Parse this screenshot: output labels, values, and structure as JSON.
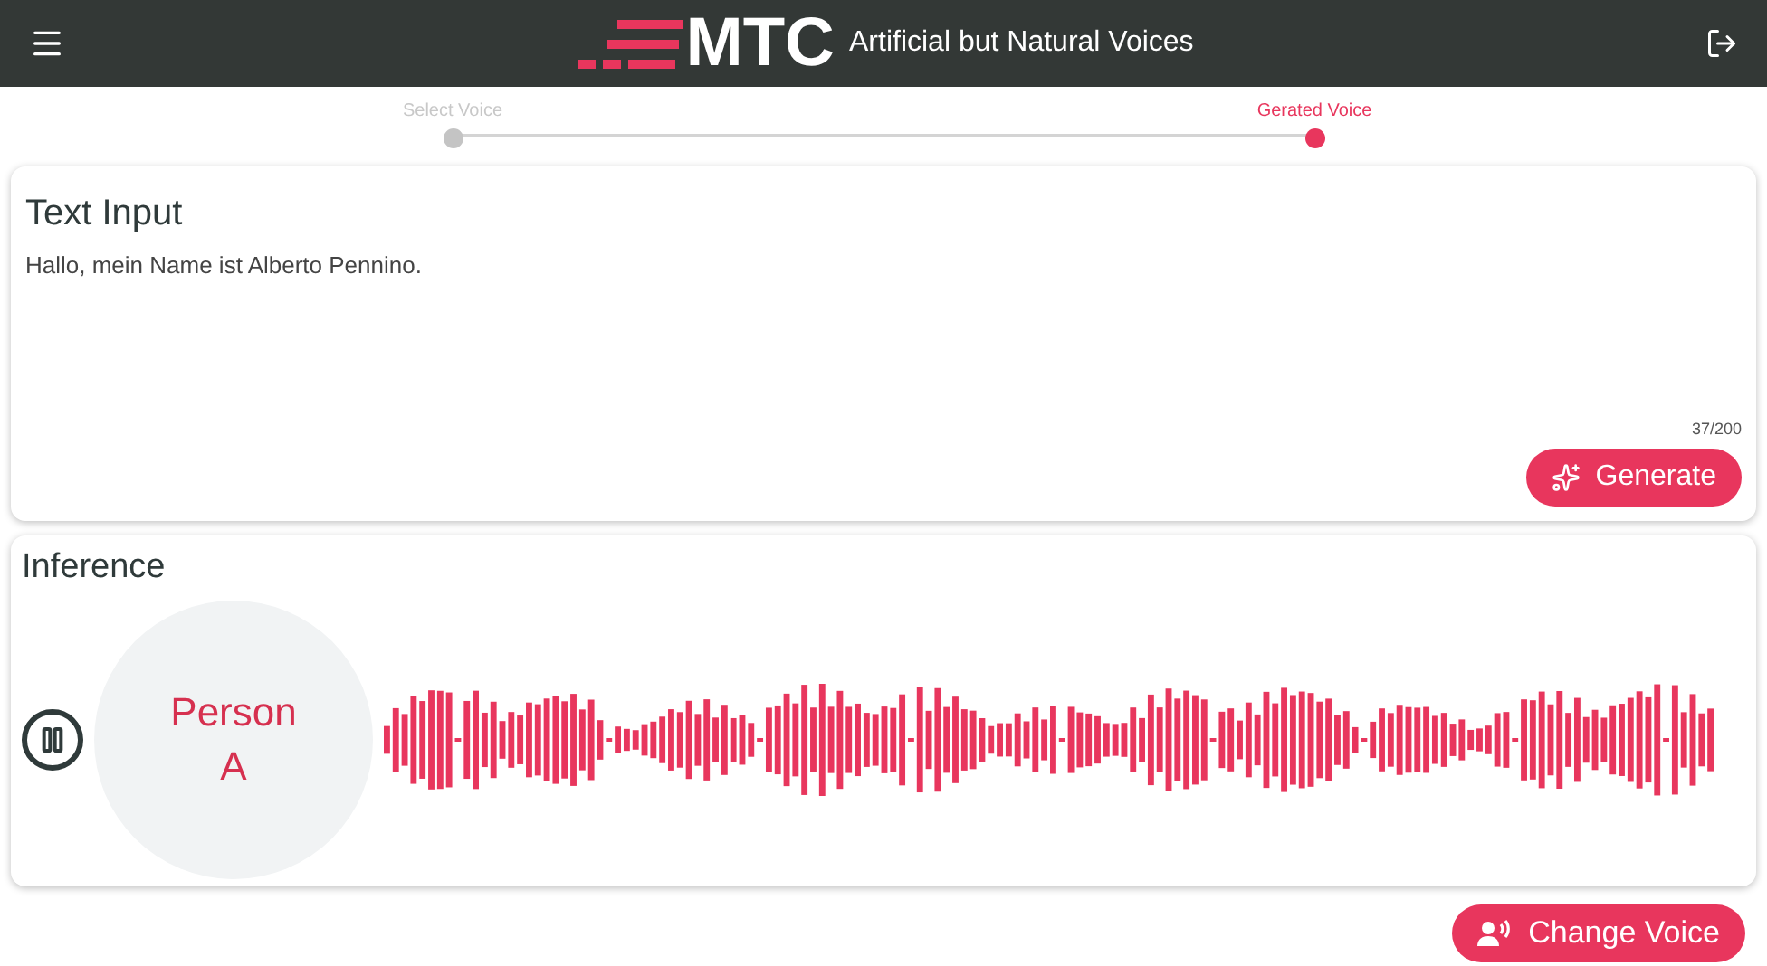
{
  "header": {
    "logo_text": "MTC",
    "title": "Artificial but Natural Voices"
  },
  "stepper": [
    {
      "label": "Select Voice",
      "selected": false
    },
    {
      "label": "Gerated Voice",
      "selected": true
    }
  ],
  "text_input": {
    "title": "Text Input",
    "value": "Hallo, mein Name ist Alberto Pennino.",
    "counter": "37/200",
    "button": "Generate"
  },
  "inference": {
    "title": "Inference",
    "playing": true,
    "speaker": "Person A"
  },
  "change_voice_button": "Change Voice"
}
